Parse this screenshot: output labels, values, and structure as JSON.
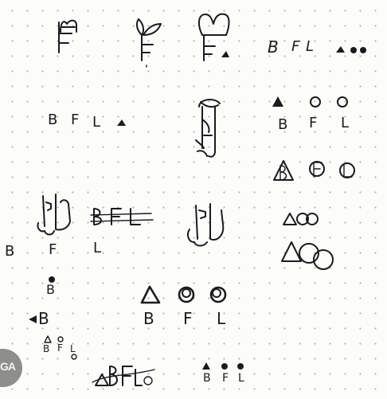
{
  "row2_left": {
    "b": "B",
    "f": "F",
    "l": "L"
  },
  "row1_right": {
    "b": "B",
    "f": "F",
    "l": "L"
  },
  "stack_right_top": {
    "b": "B",
    "f": "F",
    "l": "L"
  },
  "row4_left": {
    "b": "B",
    "f": "F",
    "l": "L"
  },
  "small_b_1": "B",
  "small_b_2": "B",
  "small_stack": {
    "b": "B",
    "f": "F",
    "l": "L"
  },
  "big_shapes": {
    "b": "B",
    "f": "F",
    "l": "L"
  },
  "bottom_right": {
    "b": "B",
    "f": "F",
    "l": "L"
  },
  "stamp_text": "GA"
}
